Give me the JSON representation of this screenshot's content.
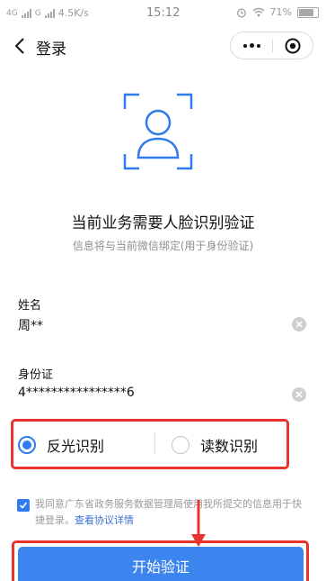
{
  "status_bar": {
    "network_1": "4G",
    "network_2": "G",
    "speed": "4.5K/s",
    "time": "15:12",
    "battery": "71%",
    "battery_level": 0.71
  },
  "nav": {
    "title": "登录"
  },
  "face": {
    "icon": "face-scan-icon",
    "color": "#2f7bf1"
  },
  "heading": "当前业务需要人脸识别验证",
  "subheading": "信息将与当前微信绑定(用于身份验证)",
  "fields": {
    "name": {
      "label": "姓名",
      "value": "周**"
    },
    "id": {
      "label": "身份证",
      "value": "4****************6"
    }
  },
  "modes": {
    "option_1": "反光识别",
    "option_2": "读数识别",
    "selected": "反光识别"
  },
  "agreement": {
    "checked": true,
    "text": "我同意广东省政务服务数据管理局使用我所提交的信息用于快捷登录。",
    "link": "查看协议详情"
  },
  "start_button": "开始验证",
  "colors": {
    "accent": "#2f7bf1",
    "button": "#3d85ee",
    "annotation": "#e8322d"
  }
}
